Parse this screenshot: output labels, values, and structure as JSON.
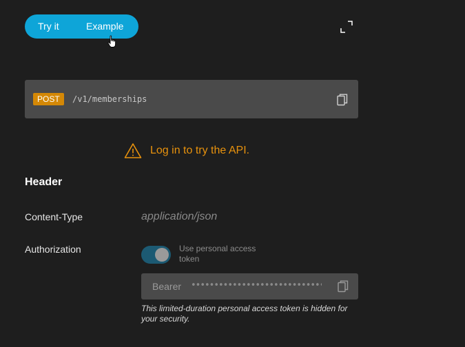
{
  "tabs": {
    "try_it": "Try it",
    "example": "Example"
  },
  "endpoint": {
    "method": "POST",
    "path": "/v1/memberships"
  },
  "warning": {
    "text": "Log in to try the API."
  },
  "header_section": {
    "title": "Header",
    "content_type_label": "Content-Type",
    "content_type_placeholder": "application/json",
    "authorization_label": "Authorization",
    "toggle_label": "Use personal access token",
    "toggle_on": true,
    "bearer_prefix": "Bearer",
    "token_masked": "••••••••••••••••••••••••••••••",
    "note": "This limited-duration personal access token is hidden for your security."
  },
  "colors": {
    "accent": "#0ea5d8",
    "method_badge": "#d48806",
    "warning": "#e8920d",
    "background": "#1e1e1e"
  },
  "icons": {
    "expand": "expand-icon",
    "copy": "copy-icon",
    "warning": "warning-triangle-icon",
    "cursor": "hand-cursor-icon"
  }
}
